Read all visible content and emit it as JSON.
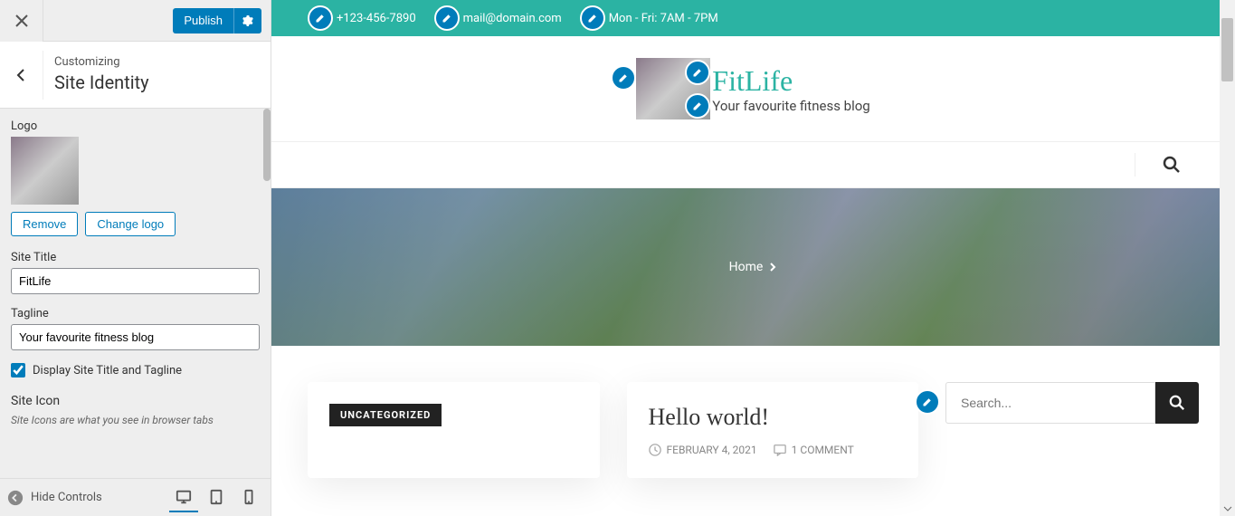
{
  "sidebar": {
    "publish_label": "Publish",
    "customizing_label": "Customizing",
    "section_title": "Site Identity",
    "logo_label": "Logo",
    "remove_label": "Remove",
    "change_logo_label": "Change logo",
    "site_title_label": "Site Title",
    "site_title_value": "FitLife",
    "tagline_label": "Tagline",
    "tagline_value": "Your favourite fitness blog",
    "display_checkbox_label": "Display Site Title and Tagline",
    "site_icon_label": "Site Icon",
    "site_icon_help": "Site Icons are what you see in browser tabs",
    "hide_controls_label": "Hide Controls"
  },
  "preview": {
    "topbar": {
      "phone": "+123-456-7890",
      "email": "mail@domain.com",
      "hours": "Mon - Fri: 7AM - 7PM"
    },
    "site_title": "FitLife",
    "site_tagline": "Your favourite fitness blog",
    "breadcrumb": "Home",
    "post1": {
      "category": "UNCATEGORIZED"
    },
    "post2": {
      "title": "Hello world!",
      "date": "FEBRUARY 4, 2021",
      "comments": "1 COMMENT"
    },
    "search_placeholder": "Search..."
  },
  "colors": {
    "accent": "#2bb3a3",
    "wp_blue": "#007cba"
  }
}
